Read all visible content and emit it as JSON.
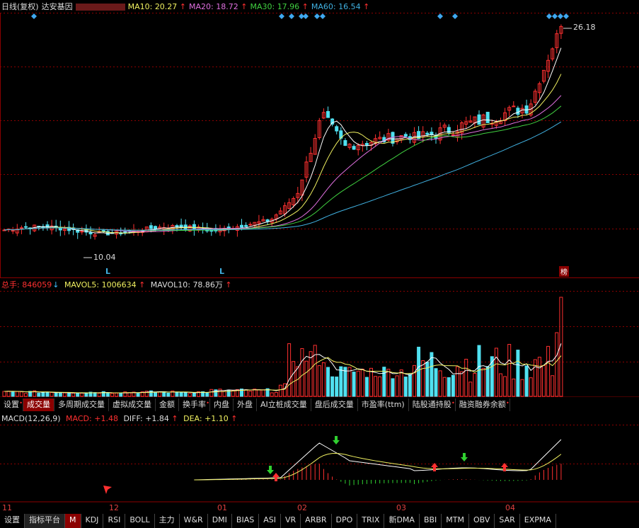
{
  "main": {
    "title": "日线(复权)",
    "stock": "达安基因",
    "ma10": {
      "label": "MA10:",
      "value": "20.27",
      "color": "#f0f060"
    },
    "ma20": {
      "label": "MA20:",
      "value": "18.72",
      "color": "#e070e0"
    },
    "ma30": {
      "label": "MA30:",
      "value": "17.96",
      "color": "#40d040"
    },
    "ma60": {
      "label": "MA60:",
      "value": "16.54",
      "color": "#40b0e0"
    },
    "high_price": "26.18",
    "low_price": "10.04",
    "marker_L": "L",
    "bang_badge": "榜"
  },
  "volume": {
    "label": "总手:",
    "value": "846059",
    "mavol5_label": "MAVOL5:",
    "mavol5_value": "1006634",
    "mavol10_label": "MAVOL10:",
    "mavol10_value": "78.86万"
  },
  "vol_tabs": [
    "设置",
    "成交量",
    "多周期成交量",
    "虚拟成交量",
    "金额",
    "换手率",
    "内盘",
    "外盘",
    "AI立桩成交量",
    "盘后成交量",
    "市盈率(ttm)",
    "陆股通持股",
    "融资融券余额"
  ],
  "macd": {
    "label": "MACD(12,26,9)",
    "macd_label": "MACD:",
    "macd_value": "+1.48",
    "diff_label": "DIFF:",
    "diff_value": "+1.84",
    "dea_label": "DEA:",
    "dea_value": "+1.10"
  },
  "months": [
    "11",
    "12",
    "01",
    "02",
    "03",
    "04"
  ],
  "bottom_tabs": [
    "设置",
    "指标平台",
    "M",
    "KDJ",
    "RSI",
    "BOLL",
    "主力",
    "W&R",
    "DMI",
    "BIAS",
    "ASI",
    "VR",
    "ARBR",
    "DPO",
    "TRIX",
    "新DMA",
    "BBI",
    "MTM",
    "OBV",
    "SAR",
    "EXPMA"
  ],
  "colors": {
    "up": "#ff3030",
    "down": "#50e0f0",
    "grid": "#8b0000"
  }
}
